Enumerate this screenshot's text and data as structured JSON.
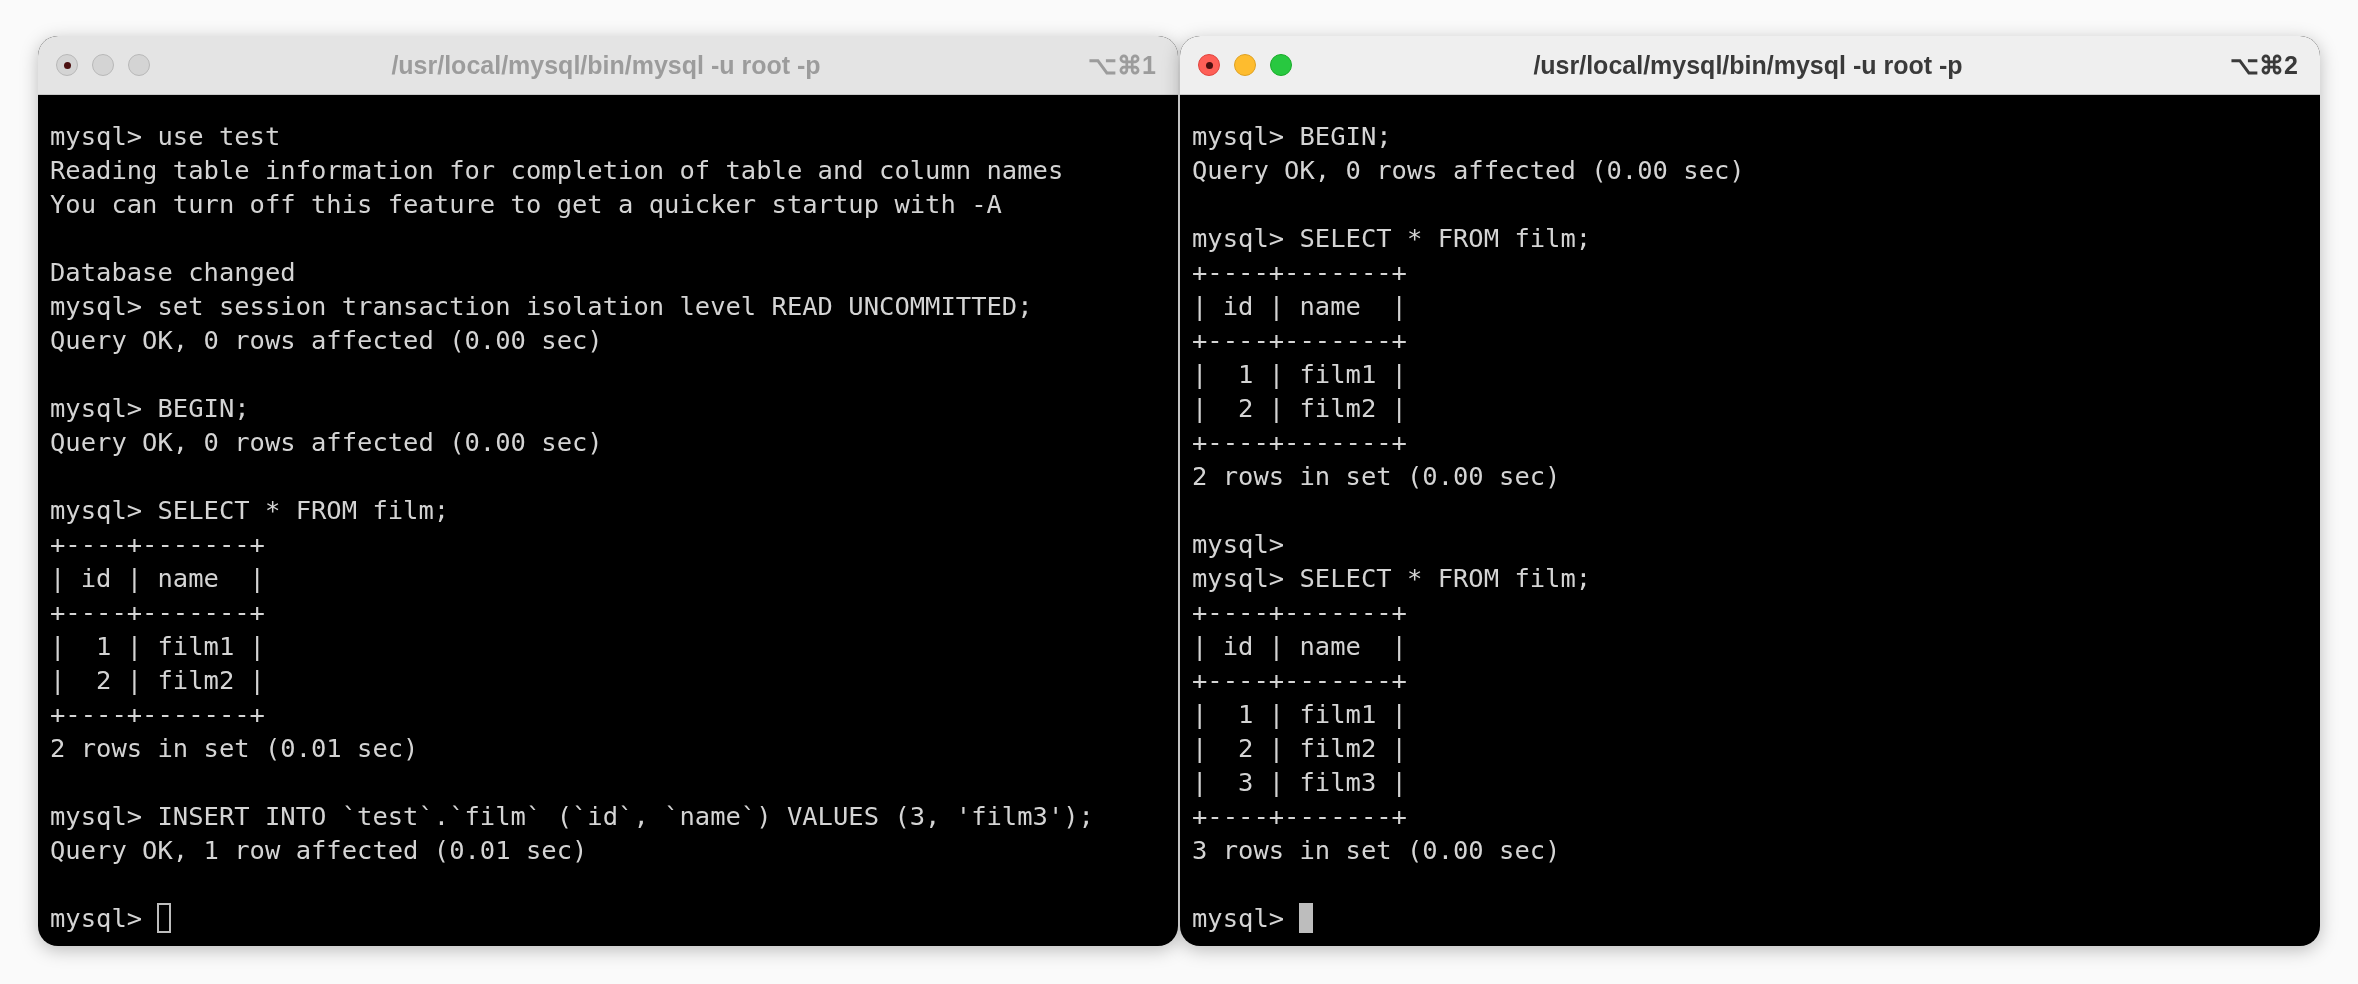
{
  "windows": [
    {
      "title": "/usr/local/mysql/bin/mysql -u root -p",
      "shortcut": "⌥⌘1",
      "active": false,
      "blocks": [
        [
          "mysql> use test",
          "Reading table information for completion of table and column names",
          "You can turn off this feature to get a quicker startup with -A"
        ],
        [
          "Database changed",
          "mysql> set session transaction isolation level READ UNCOMMITTED;",
          "Query OK, 0 rows affected (0.00 sec)"
        ],
        [
          "mysql> BEGIN;",
          "Query OK, 0 rows affected (0.00 sec)"
        ],
        [
          "mysql> SELECT * FROM film;",
          "+----+-------+",
          "| id | name  |",
          "+----+-------+",
          "|  1 | film1 |",
          "|  2 | film2 |",
          "+----+-------+",
          "2 rows in set (0.01 sec)"
        ],
        [
          "mysql> INSERT INTO `test`.`film` (`id`, `name`) VALUES (3, 'film3');",
          "Query OK, 1 row affected (0.01 sec)"
        ]
      ],
      "prompt": "mysql>"
    },
    {
      "title": "/usr/local/mysql/bin/mysql -u root -p",
      "shortcut": "⌥⌘2",
      "active": true,
      "blocks": [
        [
          "mysql> BEGIN;",
          "Query OK, 0 rows affected (0.00 sec)"
        ],
        [
          "mysql> SELECT * FROM film;",
          "+----+-------+",
          "| id | name  |",
          "+----+-------+",
          "|  1 | film1 |",
          "|  2 | film2 |",
          "+----+-------+",
          "2 rows in set (0.00 sec)"
        ],
        [
          "mysql>",
          "mysql> SELECT * FROM film;",
          "+----+-------+",
          "| id | name  |",
          "+----+-------+",
          "|  1 | film1 |",
          "|  2 | film2 |",
          "|  3 | film3 |",
          "+----+-------+",
          "3 rows in set (0.00 sec)"
        ]
      ],
      "prompt": "mysql>"
    }
  ]
}
